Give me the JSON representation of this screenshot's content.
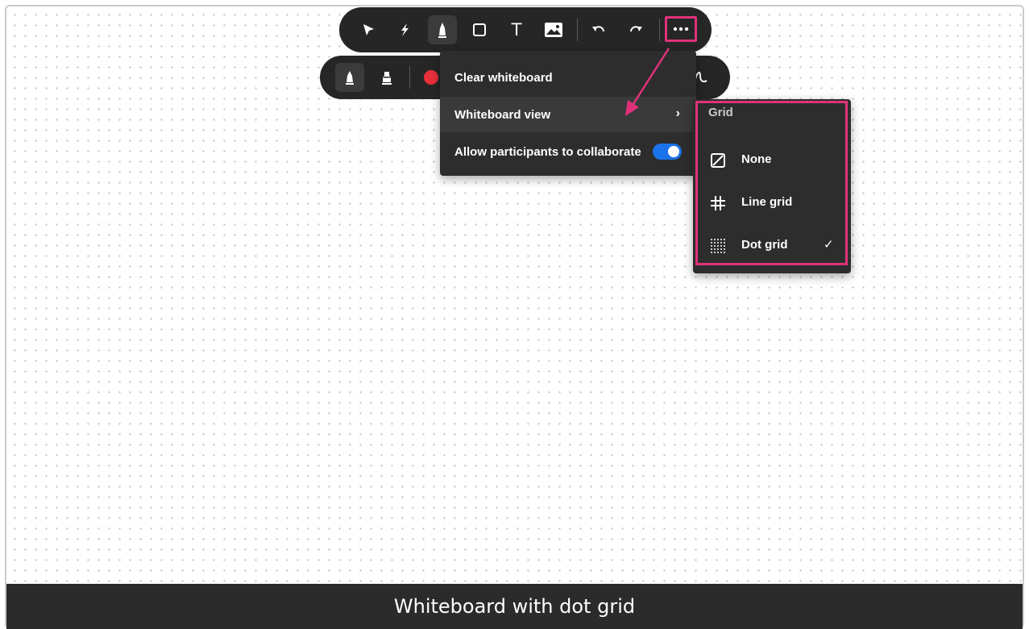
{
  "toolbar": {
    "tools": [
      {
        "name": "select",
        "icon": "cursor-icon"
      },
      {
        "name": "laser",
        "icon": "laser-icon"
      },
      {
        "name": "pen",
        "icon": "pen-icon",
        "active": true
      },
      {
        "name": "shape",
        "icon": "square-icon"
      },
      {
        "name": "text",
        "icon": "text-icon",
        "glyph": "T"
      },
      {
        "name": "image",
        "icon": "image-icon"
      },
      {
        "name": "undo",
        "icon": "undo-icon"
      },
      {
        "name": "redo",
        "icon": "redo-icon"
      },
      {
        "name": "more",
        "icon": "more-icon"
      }
    ]
  },
  "subtoolbar": {
    "tools": [
      {
        "name": "pen",
        "icon": "pen-icon",
        "active": true
      },
      {
        "name": "highlighter",
        "icon": "highlighter-icon"
      }
    ],
    "color": "#e8303a"
  },
  "menu": {
    "items": [
      {
        "label": "Clear whiteboard"
      },
      {
        "label": "Whiteboard view",
        "chevron": "›"
      },
      {
        "label": "Allow participants to collaborate",
        "toggle": true
      }
    ]
  },
  "submenu": {
    "header": "Grid",
    "items": [
      {
        "label": "None",
        "icon": "no-grid-icon",
        "checked": false
      },
      {
        "label": "Line grid",
        "icon": "line-grid-icon",
        "checked": false
      },
      {
        "label": "Dot grid",
        "icon": "dot-grid-icon",
        "checked": true,
        "check_glyph": "✓"
      }
    ]
  },
  "caption": "Whiteboard with dot grid",
  "colors": {
    "highlight": "#e0327a",
    "toggle_on": "#1a73e8",
    "toolbar_bg": "#262626"
  }
}
